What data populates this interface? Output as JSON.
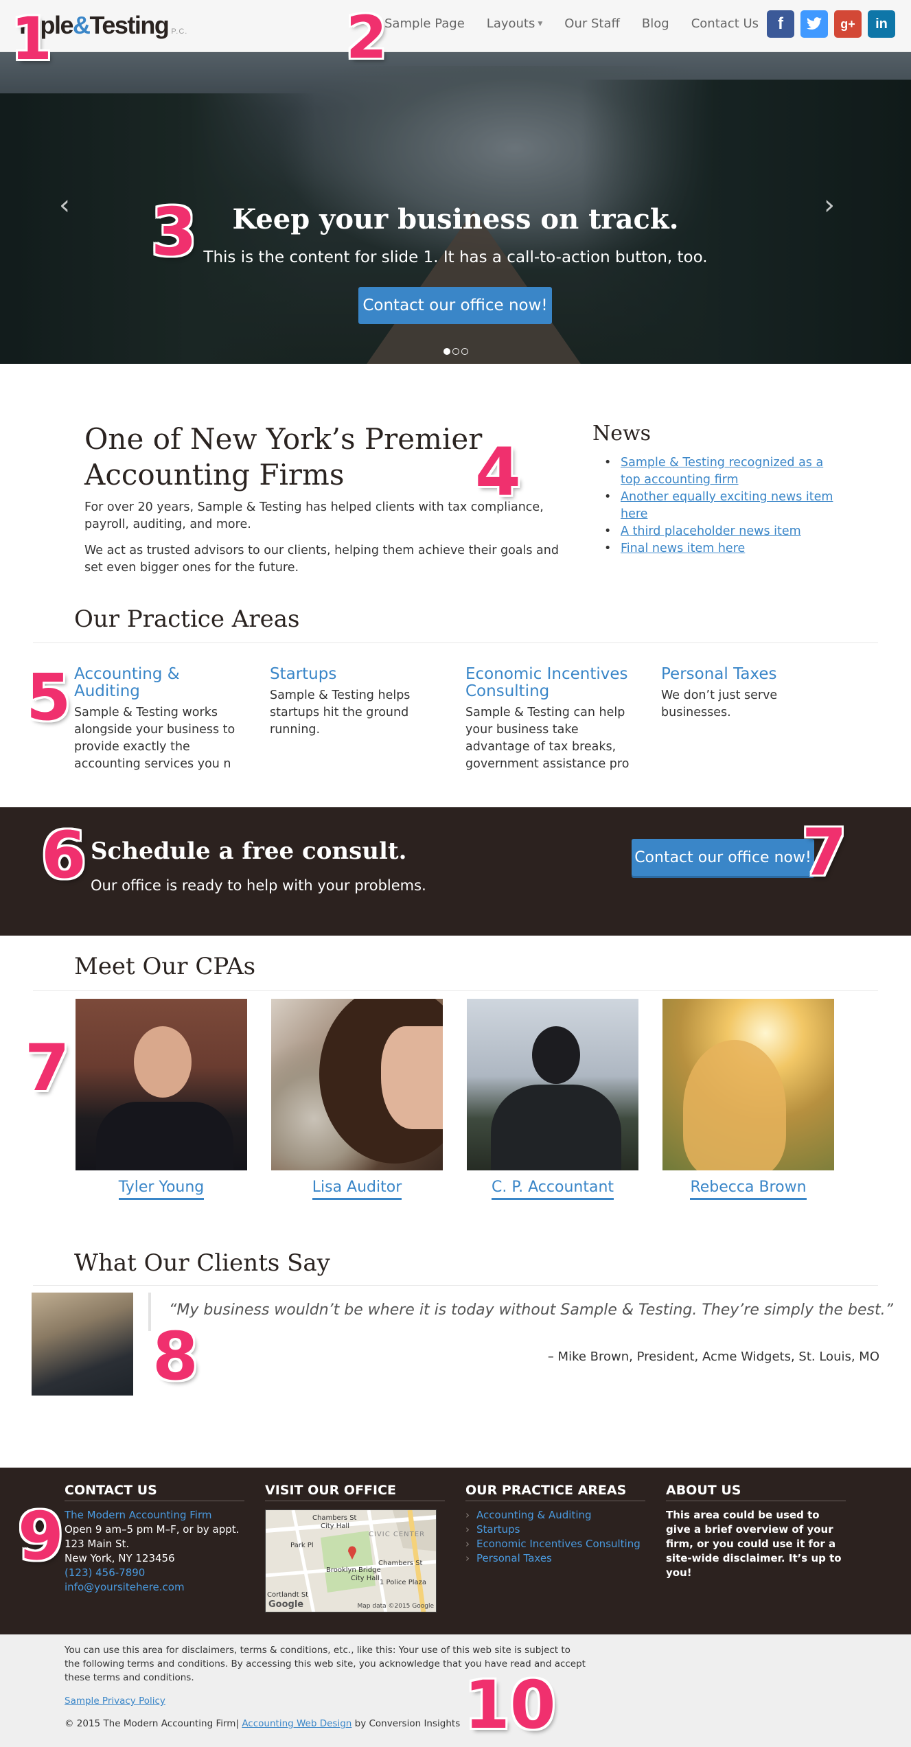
{
  "header": {
    "logo_part1": "mple",
    "logo_amp": "&",
    "logo_part2": "Testing",
    "logo_suffix": "P.C.",
    "nav": [
      "Sample Page",
      "Layouts",
      "Our Staff",
      "Blog",
      "Contact Us"
    ],
    "social": [
      {
        "name": "facebook-icon",
        "glyph": "f"
      },
      {
        "name": "twitter-icon",
        "glyph": "t"
      },
      {
        "name": "google-plus-icon",
        "glyph": "g+"
      },
      {
        "name": "linkedin-icon",
        "glyph": "in"
      }
    ]
  },
  "hero": {
    "title": "Keep your business on track.",
    "text": "This is the content for slide 1. It has a call-to-action button, too.",
    "cta": "Contact our office now!",
    "prev_glyph": "‹",
    "next_glyph": "›",
    "slide_count": 3,
    "active_slide": 1
  },
  "intro": {
    "title": "One of New York’s Premier Accounting Firms",
    "p1": "For over 20 years, Sample & Testing has helped clients with tax compliance, payroll, auditing, and more.",
    "p2": "We act as trusted advisors to our clients, helping them achieve their goals and set even bigger ones for the future."
  },
  "news": {
    "title": "News",
    "items": [
      "Sample & Testing recognized as a top accounting firm",
      "Another equally exciting news item here",
      "A third placeholder news item",
      "Final news item here"
    ]
  },
  "practice": {
    "title": "Our Practice Areas",
    "areas": [
      {
        "title": "Accounting & Auditing",
        "text": "Sample & Testing works alongside your business to provide exactly the accounting services you n"
      },
      {
        "title": "Startups",
        "text": "Sample & Testing helps startups hit the ground running."
      },
      {
        "title": "Economic Incentives Consulting",
        "text": "Sample & Testing can help your business take advantage of tax breaks, government assistance pro"
      },
      {
        "title": "Personal Taxes",
        "text": "We don’t just serve businesses."
      }
    ]
  },
  "consult": {
    "title": "Schedule a free consult.",
    "text": "Our office is ready to help with your problems.",
    "cta": "Contact our office now!"
  },
  "cpas": {
    "title": "Meet Our CPAs",
    "people": [
      "Tyler Young",
      "Lisa Auditor",
      "C. P. Accountant",
      "Rebecca Brown"
    ]
  },
  "testimonials": {
    "title": "What Our Clients Say",
    "quote": "“My business wouldn’t be where it is today without Sample & Testing. They’re simply the best.”",
    "author": "– Mike Brown, President, Acme Widgets, St. Louis, MO"
  },
  "footer": {
    "contact": {
      "title": "CONTACT US",
      "firm": "The Modern Accounting Firm",
      "hours": "Open 9 am–5 pm M–F, or by appt.",
      "street": "123 Main St.",
      "city": "New York, NY 123456",
      "phone": "(123) 456-7890",
      "email": "info@yoursitehere.com"
    },
    "office": {
      "title": "VISIT OUR OFFICE",
      "map_labels": [
        "Chambers St",
        "City Hall",
        "CIVIC CENTER",
        "Park Pl",
        "Chambers St",
        "Brooklyn Bridge",
        "City Hall",
        "1 Police Plaza",
        "Cortlandt St"
      ],
      "map_credit": "Map data ©2015 Google",
      "google_logo": "Google"
    },
    "practice": {
      "title": "OUR PRACTICE AREAS",
      "items": [
        "Accounting & Auditing",
        "Startups",
        "Economic Incentives Consulting",
        "Personal Taxes"
      ]
    },
    "about": {
      "title": "ABOUT US",
      "text": "This area could be used to give a brief overview of your firm, or you could use it for a site-wide disclaimer. It’s up to you!"
    }
  },
  "legal": {
    "text": "You can use this area for disclaimers, terms & conditions, etc., like this: Your use of this web site is subject to the following terms and conditions. By accessing this web site, you acknowledge that you have read and accept these terms and conditions.",
    "privacy": "Sample Privacy Policy",
    "copy_prefix": "© 2015 The Modern Accounting Firm|",
    "copy_link": "Accounting Web Design",
    "copy_suffix": "by Conversion Insights"
  },
  "badges": [
    "1",
    "2",
    "3",
    "4",
    "5",
    "6",
    "7",
    "7",
    "8",
    "9",
    "10"
  ],
  "colors": {
    "accent_blue": "#3a86c8",
    "dark_band": "#2c221f",
    "badge_pink": "#f0306e"
  }
}
